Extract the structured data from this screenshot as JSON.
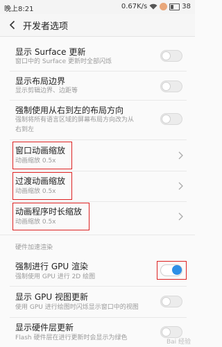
{
  "status_bar": {
    "time": "晚上8:21",
    "speed": "0.67K/s",
    "battery": "38"
  },
  "header": {
    "title": "开发者选项"
  },
  "items": [
    {
      "label": "显示 Surface 更新",
      "sub": "窗口中的 Surface 更新时全部闪烁",
      "control": "toggle",
      "on": false
    },
    {
      "label": "显示布局边界",
      "sub": "显示剪辑边界、边距等",
      "control": "toggle",
      "on": false
    },
    {
      "label": "强制使用从右到左的布局方向",
      "sub1": "强制将所有语言区域的屏幕布局方向改为从",
      "sub2": "右到左",
      "control": "toggle",
      "on": false
    },
    {
      "label": "窗口动画缩放",
      "sub": "动画缩放 0.5x",
      "control": "chevron",
      "highlighted": true
    },
    {
      "label": "过渡动画缩放",
      "sub": "动画缩放 0.5x",
      "control": "chevron",
      "highlighted": true
    },
    {
      "label": "动画程序时长缩放",
      "sub": "动画缩放 0.5x",
      "control": "chevron",
      "highlighted": true
    }
  ],
  "section_title": "硬件加速渲染",
  "hw_items": [
    {
      "label": "强制进行 GPU 渲染",
      "sub": "强制使用 GPU 进行 2D 绘图",
      "control": "toggle",
      "on": true,
      "highlighted": true
    },
    {
      "label": "显示 GPU 视图更新",
      "sub": "使用 GPU 进行绘图时闪烁显示窗口中的视图",
      "control": "toggle",
      "on": false
    },
    {
      "label": "显示硬件层更新",
      "sub": "Flash 硬件层在进行更新时会显示为绿色",
      "control": "toggle",
      "on": false
    }
  ],
  "watermark": "Bai 经验",
  "colors": {
    "accent": "#2f8fe6",
    "highlight_box": "#dd2222"
  }
}
